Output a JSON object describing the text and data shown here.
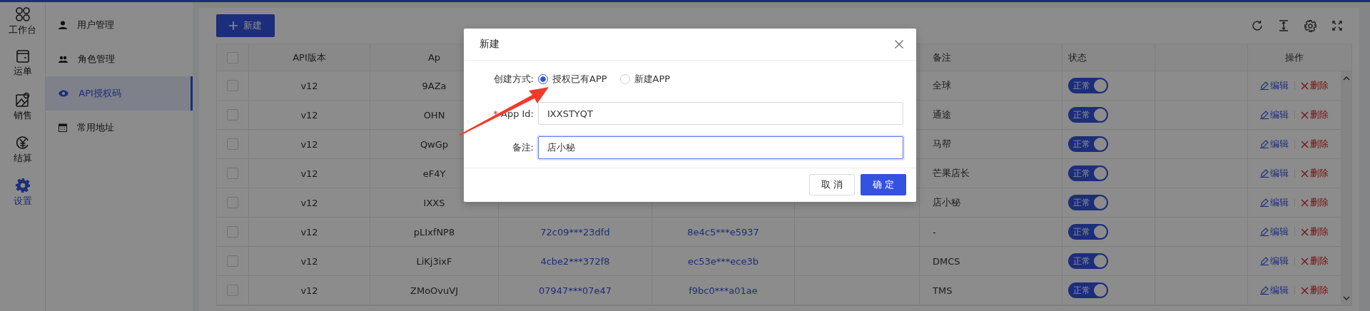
{
  "rail": [
    {
      "label": "工作台",
      "kind": "grid",
      "selected": false
    },
    {
      "label": "运单",
      "kind": "wallet",
      "selected": false
    },
    {
      "label": "销售",
      "kind": "map",
      "selected": false
    },
    {
      "label": "结算",
      "kind": "yen",
      "selected": false
    },
    {
      "label": "设置",
      "kind": "gear",
      "selected": true
    }
  ],
  "submenu": [
    {
      "label": "用户管理",
      "kind": "user",
      "selected": false
    },
    {
      "label": "角色管理",
      "kind": "team",
      "selected": false
    },
    {
      "label": "API授权码",
      "kind": "eye",
      "selected": true
    },
    {
      "label": "常用地址",
      "kind": "calendar",
      "selected": false
    }
  ],
  "toolbar": {
    "new_button": "新建"
  },
  "table": {
    "columns": {
      "api_version": "API版本",
      "app": "Ap",
      "remark": "备注",
      "status": "状态",
      "actions": "操作"
    },
    "all_checked": false,
    "rows": [
      {
        "checked": false,
        "version": "v12",
        "app": "9AZa",
        "remark": "全球",
        "status": {
          "label": "正常",
          "on": true
        },
        "edit": "编辑",
        "delete": "删除"
      },
      {
        "checked": false,
        "version": "v12",
        "app": "OHN",
        "remark": "通途",
        "status": {
          "label": "正常",
          "on": true
        },
        "edit": "编辑",
        "delete": "删除"
      },
      {
        "checked": false,
        "version": "v12",
        "app": "QwGp",
        "remark": "马帮",
        "status": {
          "label": "正常",
          "on": true
        },
        "edit": "编辑",
        "delete": "删除"
      },
      {
        "checked": false,
        "version": "v12",
        "app": "eF4Y",
        "remark": "芒果店长",
        "status": {
          "label": "正常",
          "on": true
        },
        "edit": "编辑",
        "delete": "删除"
      },
      {
        "checked": false,
        "version": "v12",
        "app": "IXXS",
        "remark": "店小秘",
        "status": {
          "label": "正常",
          "on": true
        },
        "edit": "编辑",
        "delete": "删除"
      },
      {
        "checked": false,
        "version": "v12",
        "app": "pLIxfNP8",
        "key_1": "72c09***23dfd",
        "key_2": "8e4c5***e5937",
        "remark": "-",
        "status": {
          "label": "正常",
          "on": true
        },
        "edit": "编辑",
        "delete": "删除"
      },
      {
        "checked": false,
        "version": "v12",
        "app": "LiKj3ixF",
        "key_1": "4cbe2***372f8",
        "key_2": "ec53e***ece3b",
        "remark": "DMCS",
        "status": {
          "label": "正常",
          "on": true
        },
        "edit": "编辑",
        "delete": "删除"
      },
      {
        "checked": false,
        "version": "v12",
        "app": "ZMoOvuVJ",
        "key_1": "07947***07e47",
        "key_2": "f9bc0***a01ae",
        "remark": "TMS",
        "status": {
          "label": "正常",
          "on": true
        },
        "edit": "编辑",
        "delete": "删除"
      }
    ]
  },
  "modal": {
    "title": "新建",
    "method": {
      "label": "创建方式:",
      "options": [
        {
          "label": "授权已有APP",
          "selected": true
        },
        {
          "label": "新建APP",
          "selected": false
        }
      ]
    },
    "app_id": {
      "label": "App Id:",
      "required_mark": "*",
      "value": "IXXSTYQT"
    },
    "remark": {
      "label": "备注:",
      "value": "店小秘",
      "focused": true
    },
    "buttons": [
      {
        "label": "取 消",
        "kind": "default"
      },
      {
        "label": "确 定",
        "kind": "primary"
      }
    ]
  }
}
